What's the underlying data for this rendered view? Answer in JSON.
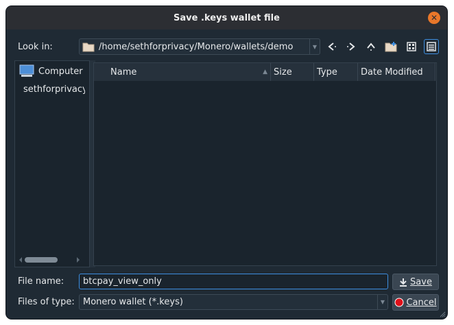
{
  "window": {
    "title": "Save .keys wallet file"
  },
  "lookin": {
    "label": "Look in:",
    "path": "/home/sethforprivacy/Monero/wallets/demo"
  },
  "sidebar": {
    "items": [
      {
        "label": "Computer",
        "icon": "computer-icon"
      },
      {
        "label": "sethforprivacy",
        "icon": "folder-icon"
      }
    ]
  },
  "columns": {
    "name": "Name",
    "size": "Size",
    "type": "Type",
    "modified": "Date Modified"
  },
  "filename": {
    "label": "File name:",
    "value": "btcpay_view_only"
  },
  "filetype": {
    "label": "Files of type:",
    "value": "Monero wallet (*.keys)"
  },
  "buttons": {
    "save": "Save",
    "cancel": "Cancel"
  },
  "colors": {
    "accent": "#3d8ee0",
    "close": "#e9772a",
    "background": "#1f2a34"
  }
}
